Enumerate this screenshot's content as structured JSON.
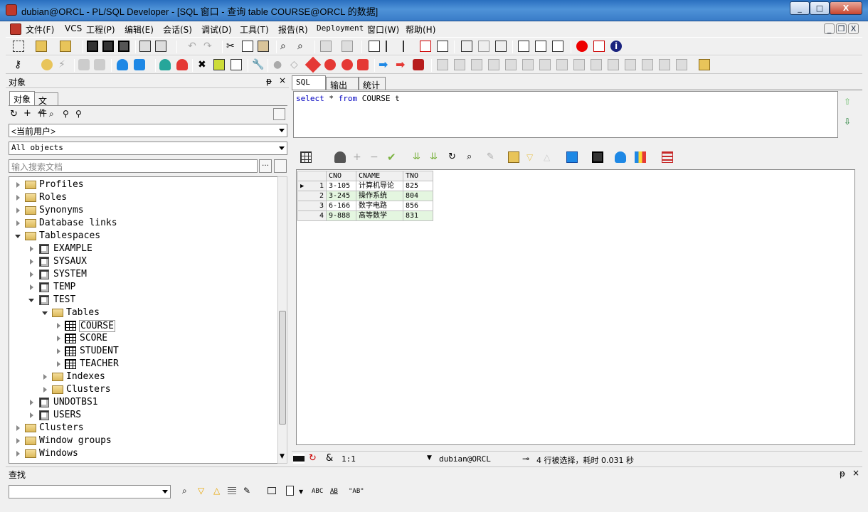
{
  "window": {
    "title": "dubian@ORCL - PL/SQL Developer - [SQL 窗口 - 查询 table COURSE@ORCL 的数据]",
    "min": "_",
    "max": "□",
    "close": "X"
  },
  "menu": [
    "文件(F)",
    "VCS",
    "工程(P)",
    "编辑(E)",
    "会话(S)",
    "调试(D)",
    "工具(T)",
    "报告(R)",
    "Deployment",
    "窗口(W)",
    "帮助(H)"
  ],
  "mdi": {
    "min": "_",
    "restore": "❐",
    "close": "X"
  },
  "objects_panel": {
    "title": "对象",
    "pin": "ᵽ",
    "close": "×",
    "tabs": [
      "对象",
      "文件"
    ],
    "user_combo": "<当前用户>",
    "filter_combo": "All objects",
    "search_placeholder": "输入搜索文档",
    "tree": [
      {
        "label": "Profiles"
      },
      {
        "label": "Roles"
      },
      {
        "label": "Synonyms"
      },
      {
        "label": "Database links"
      },
      {
        "label": "Tablespaces"
      },
      {
        "label": "EXAMPLE"
      },
      {
        "label": "SYSAUX"
      },
      {
        "label": "SYSTEM"
      },
      {
        "label": "TEMP"
      },
      {
        "label": "TEST"
      },
      {
        "label": "Tables"
      },
      {
        "label": "COURSE"
      },
      {
        "label": "SCORE"
      },
      {
        "label": "STUDENT"
      },
      {
        "label": "TEACHER"
      },
      {
        "label": "Indexes"
      },
      {
        "label": "Clusters"
      },
      {
        "label": "UNDOTBS1"
      },
      {
        "label": "USERS"
      },
      {
        "label": "Clusters"
      },
      {
        "label": "Window groups"
      },
      {
        "label": "Windows"
      }
    ]
  },
  "sql_tabs": [
    "SQL",
    "输出",
    "统计"
  ],
  "sql_text": {
    "kw1": "select",
    "mid": " * ",
    "kw2": "from",
    "rest": " COURSE t"
  },
  "result": {
    "columns": [
      "CNO",
      "CNAME",
      "TNO"
    ],
    "rows": [
      {
        "n": "1",
        "cno": "3-105",
        "cname": "计算机导论",
        "tno": "825"
      },
      {
        "n": "2",
        "cno": "3-245",
        "cname": "操作系统",
        "tno": "804"
      },
      {
        "n": "3",
        "cno": "6-166",
        "cname": "数字电路",
        "tno": "856"
      },
      {
        "n": "4",
        "cno": "9-888",
        "cname": "高等数学",
        "tno": "831"
      }
    ]
  },
  "status": {
    "pos": "1:1",
    "conn": "dubian@ORCL",
    "msg": "4 行被选择，耗时 0.031 秒"
  },
  "find": {
    "title": "查找",
    "abc": "ABC",
    "ab": "AB",
    "quoted": "\"AB\""
  }
}
